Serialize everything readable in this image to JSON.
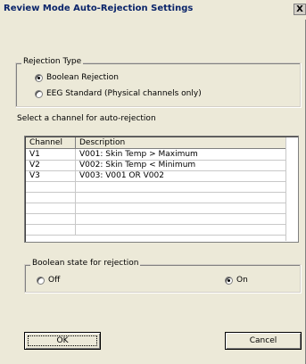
{
  "window": {
    "title": "Review Mode Auto-Rejection Settings",
    "close_glyph": "X"
  },
  "rejection_type": {
    "legend": "Rejection Type",
    "options": [
      {
        "label": "Boolean Rejection",
        "selected": true
      },
      {
        "label": "EEG Standard (Physical channels only)",
        "selected": false
      }
    ]
  },
  "channel_select_label": "Select a channel for auto-rejection",
  "channel_table": {
    "columns": [
      "Channel",
      "Description"
    ],
    "rows": [
      {
        "channel": "V1",
        "description": "V001: Skin Temp > Maximum"
      },
      {
        "channel": "V2",
        "description": "V002: Skin Temp < Minimum"
      },
      {
        "channel": "V3",
        "description": "V003: V001 OR V002"
      }
    ]
  },
  "boolean_state": {
    "legend": "Boolean state for rejection",
    "options": [
      {
        "label": "Off",
        "selected": false
      },
      {
        "label": "On",
        "selected": true
      }
    ]
  },
  "buttons": {
    "ok": "OK",
    "cancel": "Cancel"
  }
}
